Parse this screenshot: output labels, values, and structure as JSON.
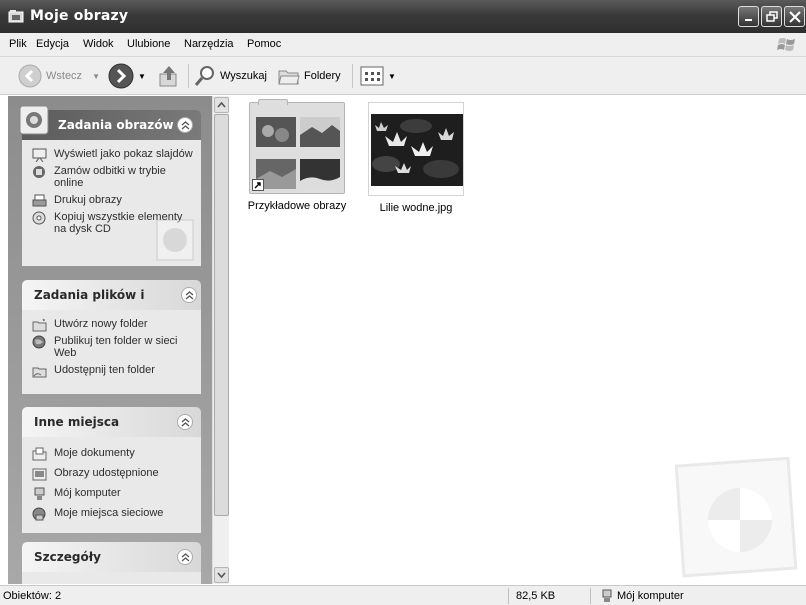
{
  "window": {
    "title": "Moje obrazy",
    "icon": "folder-pictures-icon"
  },
  "menu": {
    "items": [
      "Plik",
      "Edycja",
      "Widok",
      "Ulubione",
      "Narzędzia",
      "Pomoc"
    ]
  },
  "toolbar": {
    "back_label": "Wstecz",
    "search_label": "Wyszukaj",
    "folders_label": "Foldery"
  },
  "sidebar": {
    "groups": [
      {
        "title": "Zadania obrazów",
        "tasks": [
          {
            "label": "Wyświetl jako pokaz slajdów",
            "icon": "slideshow-icon"
          },
          {
            "label": "Zamów odbitki w trybie online",
            "icon": "order-prints-icon"
          },
          {
            "label": "Drukuj obrazy",
            "icon": "printer-icon"
          },
          {
            "label": "Kopiuj wszystkie elementy na dysk CD",
            "icon": "cd-copy-icon"
          }
        ]
      },
      {
        "title": "Zadania plików i folderów",
        "tasks": [
          {
            "label": "Utwórz nowy folder",
            "icon": "new-folder-icon"
          },
          {
            "label": "Publikuj ten folder w sieci Web",
            "icon": "publish-web-icon"
          },
          {
            "label": "Udostępnij ten folder",
            "icon": "share-folder-icon"
          }
        ]
      },
      {
        "title": "Inne miejsca",
        "tasks": [
          {
            "label": "Moje dokumenty",
            "icon": "my-documents-icon"
          },
          {
            "label": "Obrazy udostępnione",
            "icon": "shared-pictures-icon"
          },
          {
            "label": "Mój komputer",
            "icon": "my-computer-icon"
          },
          {
            "label": "Moje miejsca sieciowe",
            "icon": "network-places-icon"
          }
        ]
      },
      {
        "title": "Szczegóły",
        "tasks": []
      }
    ]
  },
  "content": {
    "items": [
      {
        "label": "Przykładowe obrazy",
        "type": "folder-shortcut"
      },
      {
        "label": "Lilie wodne.jpg",
        "type": "image"
      }
    ]
  },
  "status": {
    "objects": "Obiektów: 2",
    "size": "82,5 KB",
    "location": "Mój komputer"
  }
}
